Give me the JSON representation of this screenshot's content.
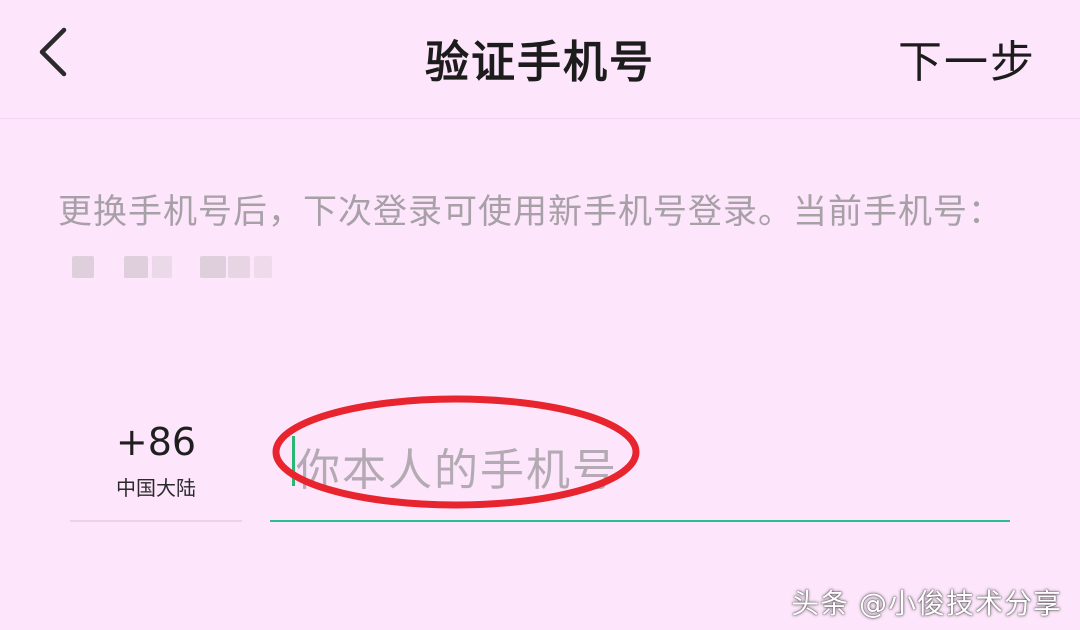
{
  "header": {
    "back_icon": "chevron-left-icon",
    "title": "验证手机号",
    "next_label": "下一步"
  },
  "info": {
    "text": "更换手机号后，下次登录可使用新手机号登录。当前手机号："
  },
  "country": {
    "code": "+86",
    "name": "中国大陆"
  },
  "phone_input": {
    "placeholder": "你本人的手机号",
    "value": ""
  },
  "colors": {
    "background": "#fde6fb",
    "accent": "#2bc08b",
    "annotation": "#e8242e"
  },
  "watermark": "头条 @小俊技术分享"
}
